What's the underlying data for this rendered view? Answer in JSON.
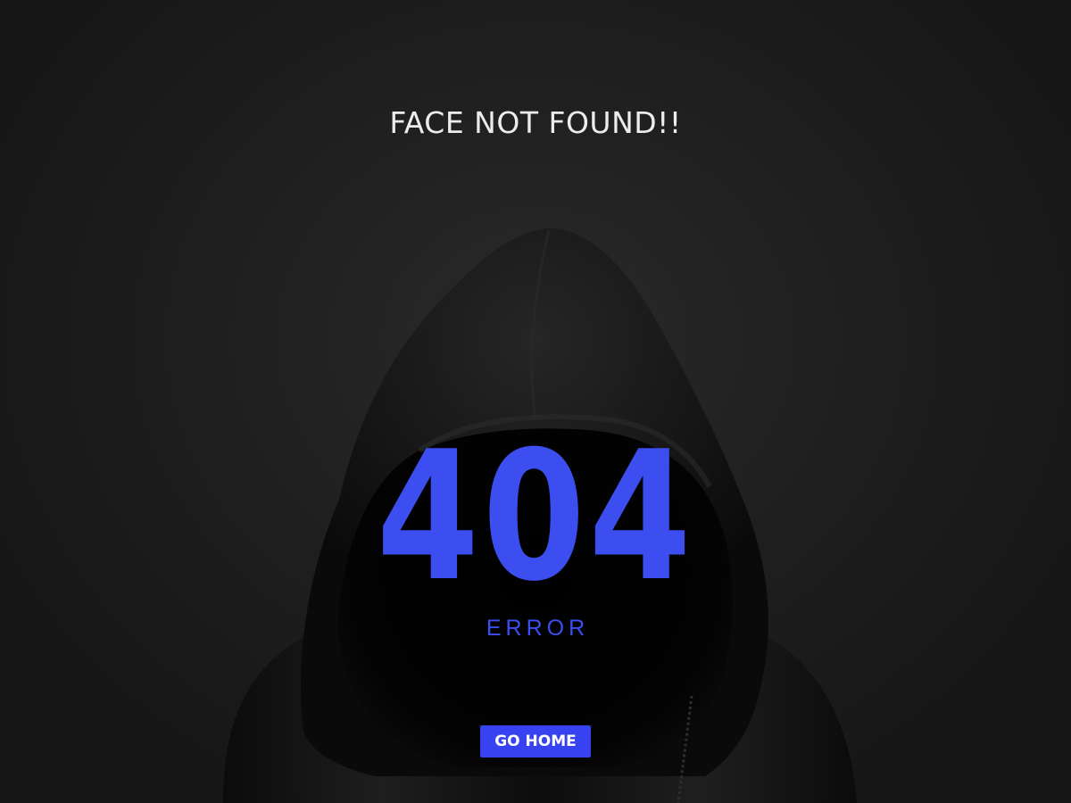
{
  "message": {
    "headline": "FACE NOT FOUND!!",
    "code": "404",
    "label": "ERROR"
  },
  "actions": {
    "home_button_label": "GO HOME"
  },
  "colors": {
    "background": "#1b1b1b",
    "accent": "#3d4ef0",
    "button": "#3742f0",
    "headline_text": "#ececec",
    "hoodie": "#0e0e0e"
  }
}
